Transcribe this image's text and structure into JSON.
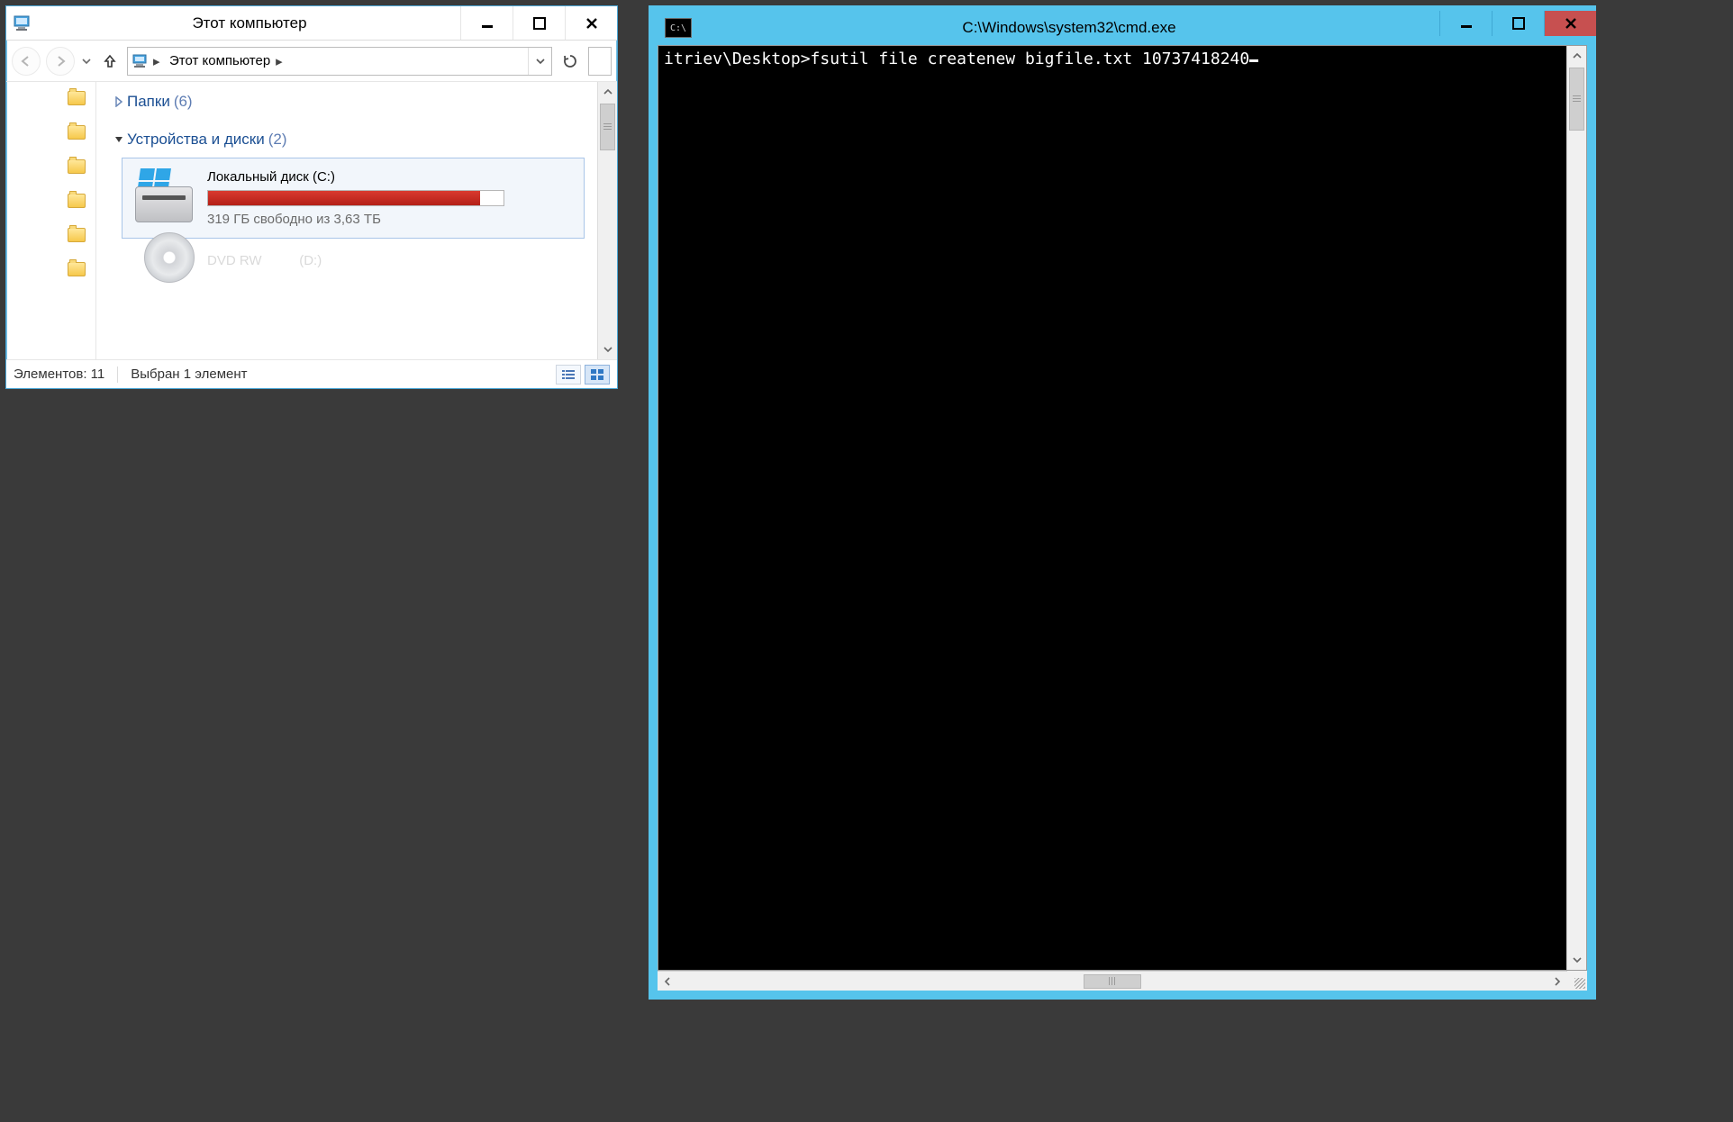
{
  "explorer": {
    "title": "Этот компьютер",
    "breadcrumb": "Этот компьютер",
    "groups": {
      "folders": {
        "label": "Папки",
        "count": "(6)",
        "expanded": false
      },
      "devices": {
        "label": "Устройства и диски",
        "count": "(2)",
        "expanded": true
      }
    },
    "drive_c": {
      "name": "Локальный диск (C:)",
      "free_text": "319 ГБ свободно из 3,63 ТБ",
      "fill_percent": 92
    },
    "drive_d_partial": "DVD RW",
    "status": {
      "items": "Элементов: 11",
      "selected": "Выбран 1 элемент"
    }
  },
  "cmd": {
    "title": "C:\\Windows\\system32\\cmd.exe",
    "line": "itriev\\Desktop>fsutil file createnew bigfile.txt 10737418240"
  }
}
